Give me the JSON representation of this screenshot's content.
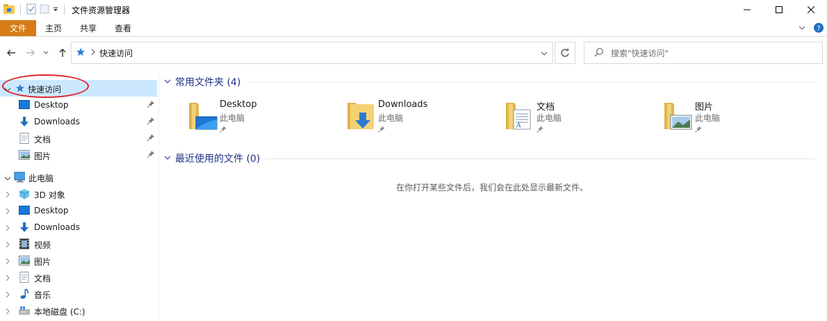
{
  "window": {
    "title": "文件资源管理器"
  },
  "ribbon": {
    "tabs": [
      "文件",
      "主页",
      "共享",
      "查看"
    ]
  },
  "address": {
    "path": "快速访问"
  },
  "search": {
    "placeholder": "搜索\"快速访问\""
  },
  "sidebar": {
    "quick_access": "快速访问",
    "pinned": [
      "Desktop",
      "Downloads",
      "文档",
      "图片"
    ],
    "this_pc": "此电脑",
    "pc_items": [
      "3D 对象",
      "Desktop",
      "Downloads",
      "视频",
      "图片",
      "文档",
      "音乐",
      "本地磁盘 (C:)"
    ]
  },
  "content": {
    "frequent_title": "常用文件夹 (4)",
    "recent_title": "最近使用的文件 (0)",
    "folders": [
      {
        "name": "Desktop",
        "location": "此电脑",
        "icon": "desktop-folder-icon"
      },
      {
        "name": "Downloads",
        "location": "此电脑",
        "icon": "downloads-folder-icon"
      },
      {
        "name": "文档",
        "location": "此电脑",
        "icon": "documents-folder-icon"
      },
      {
        "name": "图片",
        "location": "此电脑",
        "icon": "pictures-folder-icon"
      }
    ],
    "empty_message": "在你打开某些文件后，我们会在此处显示最新文件。"
  },
  "colors": {
    "file_tab": "#d67b16",
    "selection": "#cce8ff",
    "group_title": "#1e3287",
    "highlight_oval": "#e0202a"
  }
}
